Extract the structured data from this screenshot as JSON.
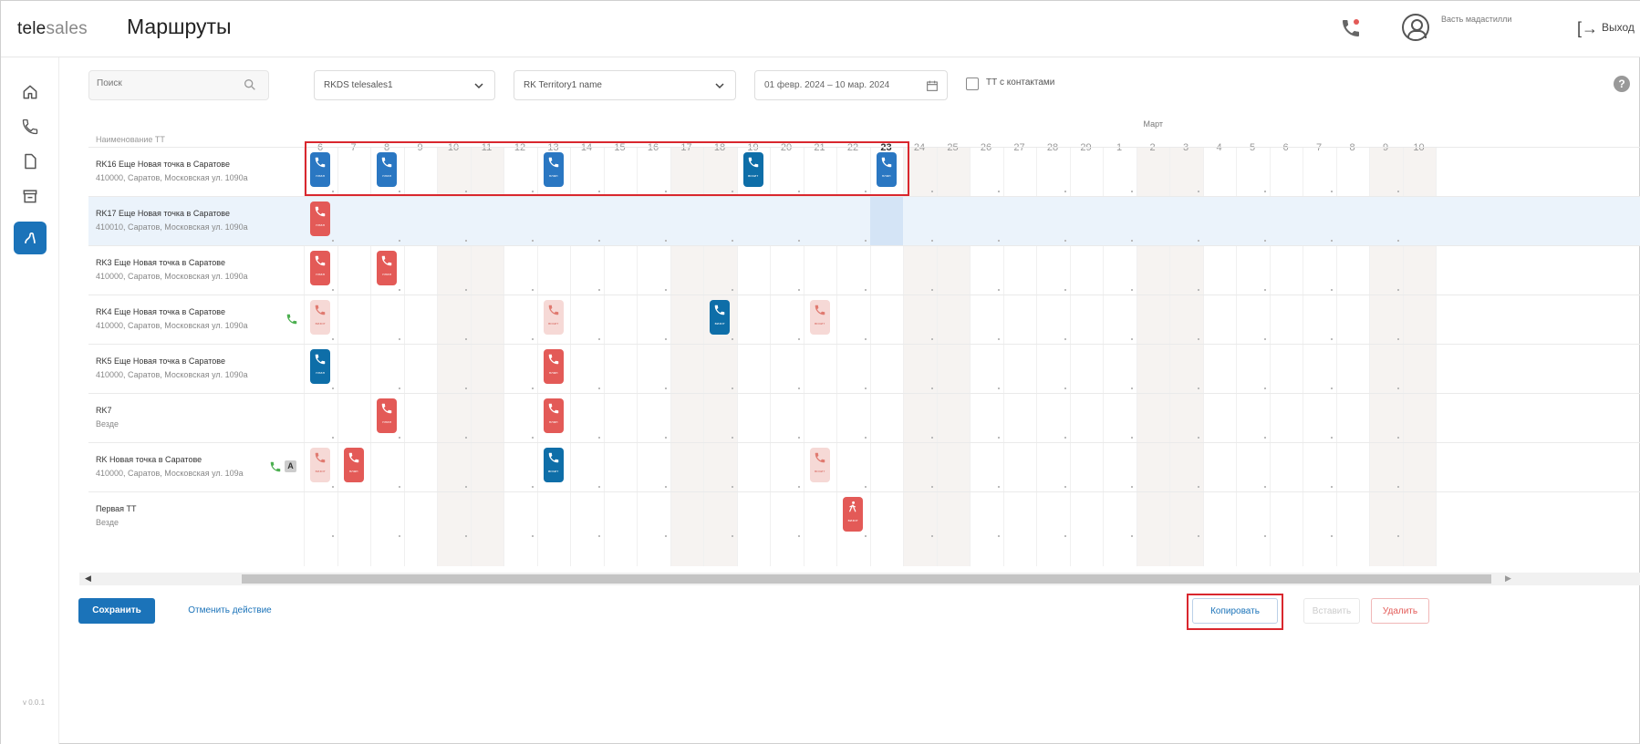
{
  "app": {
    "logo_part1": "tele",
    "logo_part2": "sales",
    "title": "Маршруты"
  },
  "header": {
    "user_name": "Васть мадастилли",
    "logout_label": "Выход"
  },
  "sidebar": {
    "version": "v 0.0.1"
  },
  "filters": {
    "search_placeholder": "Поиск",
    "team_value": "RKDS telesales1",
    "territory_value": "RK Territory1 name",
    "date_range": "01 февр. 2024  –  10 мар. 2024",
    "contacts_checkbox_label": "ТТ с контактами"
  },
  "grid": {
    "name_header": "Наименование ТТ",
    "month_label": "Март",
    "days": [
      "6",
      "7",
      "8",
      "9",
      "10",
      "11",
      "12",
      "13",
      "14",
      "15",
      "16",
      "17",
      "18",
      "19",
      "20",
      "21",
      "22",
      "23",
      "24",
      "25",
      "26",
      "27",
      "28",
      "29",
      "1",
      "2",
      "3",
      "4",
      "5",
      "6",
      "7",
      "8",
      "9",
      "10"
    ],
    "today_index": 17,
    "rows": [
      {
        "name": "RK16 Еще Новая точка в Саратове",
        "address": "410000, Саратов, Московская ул. 1090а"
      },
      {
        "name": "RK17 Еще Новая точка в Саратове",
        "address": "410010, Саратов, Московская ул. 1090а"
      },
      {
        "name": "RK3 Еще Новая точка в Саратове",
        "address": "410000, Саратов, Московская ул. 1090а"
      },
      {
        "name": "RK4 Еще Новая точка в Саратове",
        "address": "410000, Саратов, Московская ул. 1090а"
      },
      {
        "name": "RK5 Еще Новая точка в Саратове",
        "address": "410000, Саратов, Московская ул. 1090а"
      },
      {
        "name": "RK7",
        "address": "Везде"
      },
      {
        "name": "RK Новая точка в Саратове",
        "address": "410000, Саратов, Московская ул. 109а"
      },
      {
        "name": "Первая ТТ",
        "address": "Везде"
      }
    ],
    "events": [
      {
        "row": 0,
        "day": 0,
        "type": "call",
        "color": "blue",
        "label": "план"
      },
      {
        "row": 0,
        "day": 2,
        "type": "call",
        "color": "blue",
        "label": "план"
      },
      {
        "row": 0,
        "day": 7,
        "type": "call",
        "color": "blue",
        "label": "план"
      },
      {
        "row": 0,
        "day": 13,
        "type": "call",
        "color": "dblue",
        "label": "визит"
      },
      {
        "row": 0,
        "day": 17,
        "type": "call",
        "color": "blue",
        "label": "план"
      },
      {
        "row": 1,
        "day": 0,
        "type": "call",
        "color": "red",
        "label": "план"
      },
      {
        "row": 2,
        "day": 0,
        "type": "call",
        "color": "red",
        "label": "план"
      },
      {
        "row": 2,
        "day": 2,
        "type": "call",
        "color": "red",
        "label": "план"
      },
      {
        "row": 3,
        "day": 0,
        "type": "call",
        "color": "pink",
        "label": "визит"
      },
      {
        "row": 3,
        "day": 7,
        "type": "call",
        "color": "pink",
        "label": "визит"
      },
      {
        "row": 3,
        "day": 12,
        "type": "call",
        "color": "dblue",
        "label": "визит"
      },
      {
        "row": 3,
        "day": 15,
        "type": "call",
        "color": "pink",
        "label": "визит"
      },
      {
        "row": 4,
        "day": 0,
        "type": "call",
        "color": "dblue",
        "label": "план"
      },
      {
        "row": 4,
        "day": 7,
        "type": "call",
        "color": "red",
        "label": "план"
      },
      {
        "row": 5,
        "day": 2,
        "type": "call",
        "color": "red",
        "label": "план"
      },
      {
        "row": 5,
        "day": 7,
        "type": "call",
        "color": "red",
        "label": "план"
      },
      {
        "row": 6,
        "day": 0,
        "type": "call",
        "color": "pink",
        "label": "визит"
      },
      {
        "row": 6,
        "day": 1,
        "type": "call",
        "color": "red",
        "label": "план"
      },
      {
        "row": 6,
        "day": 7,
        "type": "call",
        "color": "dblue",
        "label": "визит"
      },
      {
        "row": 6,
        "day": 15,
        "type": "call",
        "color": "pink",
        "label": "визит"
      },
      {
        "row": 7,
        "day": 16,
        "type": "walk",
        "color": "red",
        "label": "визит"
      }
    ]
  },
  "footer": {
    "save_label": "Сохранить",
    "undo_label": "Отменить действие",
    "copy_label": "Копировать",
    "paste_label": "Вставить",
    "delete_label": "Удалить"
  },
  "colors": {
    "primary": "#1b73b9",
    "blue_event": "#2a77c2",
    "dark_blue_event": "#0e6ea8",
    "red_event": "#e35a57",
    "pink_event": "#f6d9d6",
    "highlight": "#d9272e"
  }
}
